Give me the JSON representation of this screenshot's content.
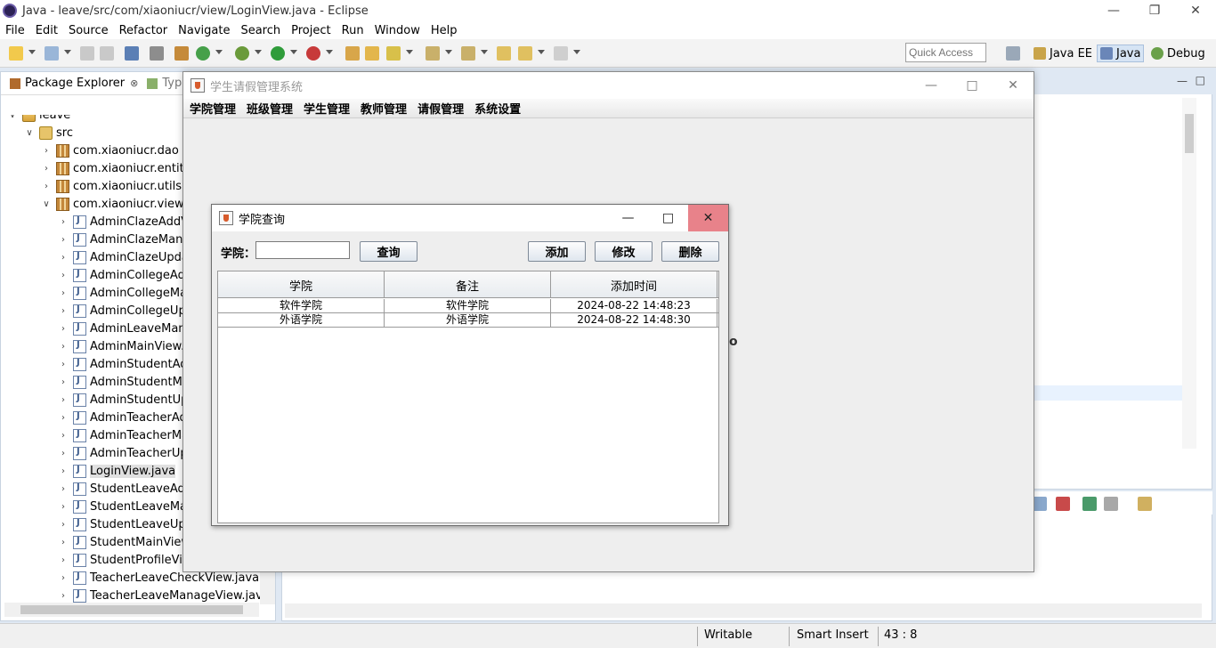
{
  "window": {
    "title": "Java - leave/src/com/xiaoniucr/view/LoginView.java - Eclipse"
  },
  "menu": [
    "File",
    "Edit",
    "Source",
    "Refactor",
    "Navigate",
    "Search",
    "Project",
    "Run",
    "Window",
    "Help"
  ],
  "toolbar": {
    "quick_access_placeholder": "Quick Access",
    "perspectives": [
      "Java EE",
      "Java",
      "Debug"
    ]
  },
  "package_explorer": {
    "tab_label": "Package Explorer",
    "tab2_label": "Type",
    "tree": [
      {
        "label": "leave",
        "type": "project",
        "depth": 0,
        "expanded": true
      },
      {
        "label": "src",
        "type": "src",
        "depth": 1,
        "expanded": true
      },
      {
        "label": "com.xiaoniucr.dao",
        "type": "package",
        "depth": 2,
        "expanded": false
      },
      {
        "label": "com.xiaoniucr.entity",
        "type": "package",
        "depth": 2,
        "expanded": false
      },
      {
        "label": "com.xiaoniucr.utils",
        "type": "package",
        "depth": 2,
        "expanded": false
      },
      {
        "label": "com.xiaoniucr.view",
        "type": "package",
        "depth": 2,
        "expanded": true
      },
      {
        "label": "AdminClazeAddView.java",
        "type": "java",
        "depth": 3
      },
      {
        "label": "AdminClazeManageView.java",
        "type": "java",
        "depth": 3
      },
      {
        "label": "AdminClazeUpdateView.java",
        "type": "java",
        "depth": 3
      },
      {
        "label": "AdminCollegeAddView.java",
        "type": "java",
        "depth": 3
      },
      {
        "label": "AdminCollegeManageView.java",
        "type": "java",
        "depth": 3
      },
      {
        "label": "AdminCollegeUpdateView.java",
        "type": "java",
        "depth": 3
      },
      {
        "label": "AdminLeaveManageView.java",
        "type": "java",
        "depth": 3
      },
      {
        "label": "AdminMainView.java",
        "type": "java",
        "depth": 3
      },
      {
        "label": "AdminStudentAddView.java",
        "type": "java",
        "depth": 3
      },
      {
        "label": "AdminStudentManageView.java",
        "type": "java",
        "depth": 3
      },
      {
        "label": "AdminStudentUpdateView.java",
        "type": "java",
        "depth": 3
      },
      {
        "label": "AdminTeacherAddView.java",
        "type": "java",
        "depth": 3
      },
      {
        "label": "AdminTeacherManageView.java",
        "type": "java",
        "depth": 3
      },
      {
        "label": "AdminTeacherUpdateView.java",
        "type": "java",
        "depth": 3
      },
      {
        "label": "LoginView.java",
        "type": "java",
        "depth": 3,
        "selected": true
      },
      {
        "label": "StudentLeaveAddView.java",
        "type": "java",
        "depth": 3
      },
      {
        "label": "StudentLeaveManageView.java",
        "type": "java",
        "depth": 3
      },
      {
        "label": "StudentLeaveUpdateView.java",
        "type": "java",
        "depth": 3
      },
      {
        "label": "StudentMainView.java",
        "type": "java",
        "depth": 3
      },
      {
        "label": "StudentProfileView.java",
        "type": "java",
        "depth": 3
      },
      {
        "label": "TeacherLeaveCheckView.java",
        "type": "java",
        "depth": 3
      },
      {
        "label": "TeacherLeaveManageView.java",
        "type": "java",
        "depth": 3
      }
    ]
  },
  "status": {
    "writable": "Writable",
    "insert_mode": "Smart Insert",
    "position": "43 : 8"
  },
  "app_frame": {
    "title": "学生请假管理系统",
    "menus": [
      "学院管理",
      "班级管理",
      "学生管理",
      "教师管理",
      "请假管理",
      "系统设置"
    ]
  },
  "dialog": {
    "title": "学院查询",
    "college_label": "学院：",
    "college_input_value": "",
    "query_button": "查询",
    "add_button": "添加",
    "edit_button": "修改",
    "delete_button": "删除",
    "table": {
      "columns": [
        "学院",
        "备注",
        "添加时间"
      ],
      "rows": [
        [
          "软件学院",
          "软件学院",
          "2024-08-22 14:48:23"
        ],
        [
          "外语学院",
          "外语学院",
          "2024-08-22 14:48:30"
        ]
      ]
    }
  },
  "colors": {
    "dialog_close_hover": "#e8828a",
    "selection": "#e0e0e0",
    "eclipse_bg": "#dfe8f3"
  }
}
